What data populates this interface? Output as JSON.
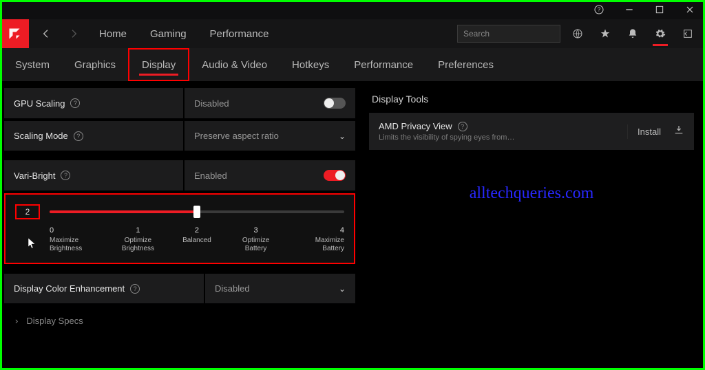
{
  "titlebar": {
    "help": "?",
    "min": "—",
    "max": "▢",
    "close": "✕"
  },
  "topnav": {
    "links": [
      "Home",
      "Gaming",
      "Performance"
    ],
    "search_ph": "Search"
  },
  "subtabs": [
    "System",
    "Graphics",
    "Display",
    "Audio & Video",
    "Hotkeys",
    "Performance",
    "Preferences"
  ],
  "active_subtab": 2,
  "settings": {
    "gpu_scaling": {
      "label": "GPU Scaling",
      "value": "Disabled",
      "on": false
    },
    "scaling_mode": {
      "label": "Scaling Mode",
      "value": "Preserve aspect ratio"
    },
    "vari_bright": {
      "label": "Vari-Bright",
      "value": "Enabled",
      "on": true
    },
    "dce": {
      "label": "Display Color Enhancement",
      "value": "Disabled"
    }
  },
  "slider": {
    "value": "2",
    "percent": 50,
    "stops": [
      {
        "n": "0",
        "t1": "Maximize",
        "t2": "Brightness"
      },
      {
        "n": "1",
        "t1": "Optimize",
        "t2": "Brightness"
      },
      {
        "n": "2",
        "t1": "Balanced",
        "t2": ""
      },
      {
        "n": "3",
        "t1": "Optimize",
        "t2": "Battery"
      },
      {
        "n": "4",
        "t1": "Maximize",
        "t2": "Battery"
      }
    ]
  },
  "specs_label": "Display Specs",
  "right": {
    "title": "Display Tools",
    "card": {
      "title": "AMD Privacy View",
      "sub": "Limits the visibility of spying eyes from seeing w...",
      "action": "Install"
    }
  },
  "watermark": "alltechqueries.com"
}
